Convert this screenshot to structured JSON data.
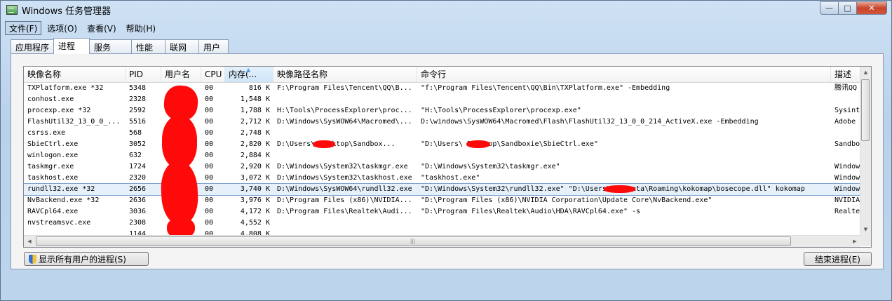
{
  "window": {
    "title": "Windows 任务管理器",
    "controls": {
      "minimize": "—",
      "maximize": "□",
      "close": "✕"
    }
  },
  "menu": [
    {
      "label": "文件(F)"
    },
    {
      "label": "选项(O)"
    },
    {
      "label": "查看(V)"
    },
    {
      "label": "帮助(H)"
    }
  ],
  "tabs": [
    {
      "label": "应用程序"
    },
    {
      "label": "进程"
    },
    {
      "label": "服务"
    },
    {
      "label": "性能"
    },
    {
      "label": "联网"
    },
    {
      "label": "用户"
    }
  ],
  "columns": {
    "image": "映像名称",
    "pid": "PID",
    "user": "用户名",
    "cpu": "CPU",
    "mem": "内存(...",
    "path": "映像路径名称",
    "cmd": "命令行",
    "desc": "描述"
  },
  "processes": [
    {
      "image": "TXPlatform.exe *32",
      "pid": "5348",
      "user": "",
      "cpu": "00",
      "mem": "816 K",
      "path": "F:\\Program Files\\Tencent\\QQ\\B...",
      "cmd": "\"f:\\Program Files\\Tencent\\QQ\\Bin\\TXPlatform.exe\" -Embedding",
      "desc": "腾讯QQ"
    },
    {
      "image": "conhost.exe",
      "pid": "2328",
      "user": "",
      "cpu": "00",
      "mem": "1,548 K",
      "path": "",
      "cmd": "",
      "desc": ""
    },
    {
      "image": "procexp.exe *32",
      "pid": "2592",
      "user": "",
      "cpu": "00",
      "mem": "1,788 K",
      "path": "H:\\Tools\\ProcessExplorer\\proc...",
      "cmd": "\"H:\\Tools\\ProcessExplorer\\procexp.exe\"",
      "desc": "Sysint"
    },
    {
      "image": "FlashUtil32_13_0_0_...",
      "pid": "5516",
      "user": "",
      "cpu": "00",
      "mem": "2,712 K",
      "path": "D:\\Windows\\SysWOW64\\Macromed\\...",
      "cmd": "D:\\windows\\SysWOW64\\Macromed\\Flash\\FlashUtil32_13_0_0_214_ActiveX.exe -Embedding",
      "desc": "Adobe"
    },
    {
      "image": "csrss.exe",
      "pid": "568",
      "user": "",
      "cpu": "00",
      "mem": "2,748 K",
      "path": "",
      "cmd": "",
      "desc": ""
    },
    {
      "image": "SbieCtrl.exe",
      "pid": "3052",
      "user": "",
      "cpu": "00",
      "mem": "2,820 K",
      "path": "D:\\Users\\       Desktop\\Sandbox...",
      "cmd": "\"D:\\Users\\         Desktop\\Sandboxie\\SbieCtrl.exe\"",
      "desc": "Sandbo"
    },
    {
      "image": "winlogon.exe",
      "pid": "632",
      "user": "",
      "cpu": "00",
      "mem": "2,884 K",
      "path": "",
      "cmd": "",
      "desc": ""
    },
    {
      "image": "taskmgr.exe",
      "pid": "1724",
      "user": "",
      "cpu": "00",
      "mem": "2,920 K",
      "path": "D:\\Windows\\System32\\taskmgr.exe",
      "cmd": "\"D:\\Windows\\System32\\taskmgr.exe\"",
      "desc": "Window"
    },
    {
      "image": "taskhost.exe",
      "pid": "2320",
      "user": "",
      "cpu": "00",
      "mem": "3,072 K",
      "path": "D:\\Windows\\System32\\taskhost.exe",
      "cmd": "\"taskhost.exe\"",
      "desc": "Window"
    },
    {
      "image": "rundll32.exe *32",
      "pid": "2656",
      "user": "",
      "cpu": "00",
      "mem": "3,740 K",
      "path": "D:\\Windows\\SysWOW64\\rundll32.exe",
      "cmd": "\"D:\\Windows\\System32\\rundll32.exe\" \"D:\\Users\\         AppData\\Roaming\\kokomap\\bosecope.dll\" kokomap",
      "desc": "Window",
      "selected": true
    },
    {
      "image": "NvBackend.exe *32",
      "pid": "2636",
      "user": "",
      "cpu": "00",
      "mem": "3,976 K",
      "path": "D:\\Program Files (x86)\\NVIDIA...",
      "cmd": "\"D:\\Program Files (x86)\\NVIDIA Corporation\\Update Core\\NvBackend.exe\"",
      "desc": "NVIDIA"
    },
    {
      "image": "RAVCpl64.exe",
      "pid": "3036",
      "user": "",
      "cpu": "00",
      "mem": "4,172 K",
      "path": "D:\\Program Files\\Realtek\\Audi...",
      "cmd": "\"D:\\Program Files\\Realtek\\Audio\\HDA\\RAVCpl64.exe\" -s",
      "desc": "Realte"
    },
    {
      "image": "nvstreamsvc.exe",
      "pid": "2308",
      "user": "",
      "cpu": "00",
      "mem": "4,552 K",
      "path": "",
      "cmd": "",
      "desc": ""
    },
    {
      "image": "",
      "pid": "1144",
      "user": "",
      "cpu": "00",
      "mem": "4,808 K",
      "path": "",
      "cmd": "",
      "desc": ""
    }
  ],
  "scroll": {
    "up": "▲",
    "down": "▼",
    "left": "◀",
    "right": "▶",
    "grip": "|||"
  },
  "buttons": {
    "show_all": "显示所有用户的进程(S)",
    "end_process": "结束进程(E)"
  }
}
